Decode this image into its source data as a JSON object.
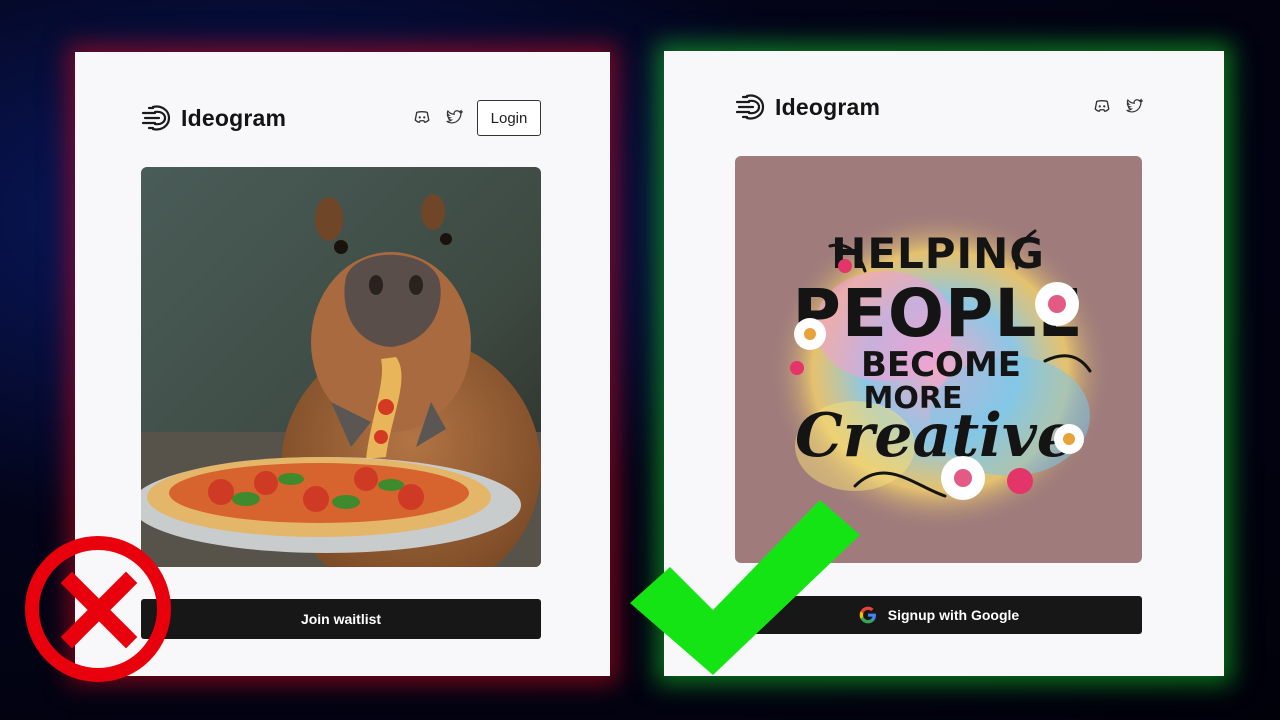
{
  "left_panel": {
    "brand": "Ideogram",
    "login_label": "Login",
    "cta_label": "Join waitlist",
    "image_subject": "capybara eating pizza"
  },
  "right_panel": {
    "brand": "Ideogram",
    "cta_label": "Signup with Google",
    "image_text": "HELPING PEOPLE BECOME MORE Creative"
  },
  "icons": [
    "discord-icon",
    "twitter-icon",
    "google-icon",
    "logo-icon",
    "cross-icon",
    "checkmark-icon"
  ],
  "colors": {
    "left_glow": "#c80a1e",
    "right_glow": "#14c828",
    "cross": "#e8000c",
    "check": "#14e414",
    "cta_bg": "#171717"
  }
}
